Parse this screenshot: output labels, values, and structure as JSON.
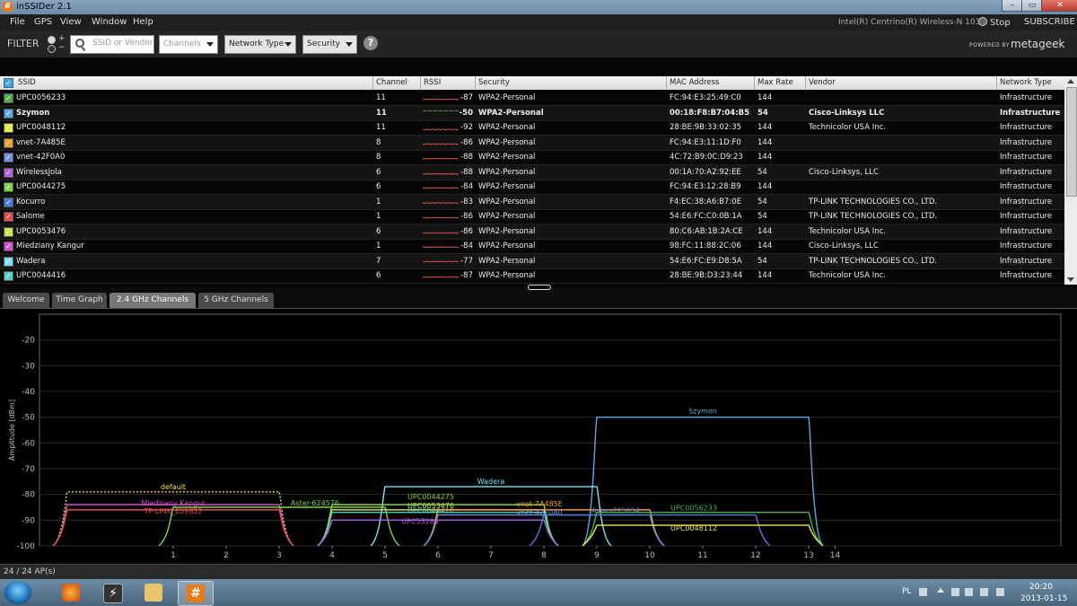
{
  "window": {
    "title": "inSSIDer 2.1",
    "app_icon": "#"
  },
  "menu": {
    "items": [
      "File",
      "GPS",
      "View",
      "Window",
      "Help"
    ],
    "adapter": "Intel(R) Centrino(R) Wireless-N 1030",
    "stop": "Stop",
    "subscribe": "SUBSCRIBE"
  },
  "filter": {
    "label": "FILTER",
    "plus": "+",
    "minus": "−",
    "search_placeholder": "SSID or Vendor",
    "channels": "Channels",
    "network_type": "Network Type",
    "security": "Security",
    "help": "?",
    "powered_by": "POWERED BY",
    "brand": "metageek"
  },
  "table": {
    "columns": [
      "SSID",
      "Channel",
      "RSSI",
      "Security",
      "MAC Address",
      "Max Rate",
      "Vendor",
      "Network Type"
    ],
    "rows": [
      {
        "ssid": "UPC0056233",
        "channel": "11",
        "rssi": "-87",
        "security": "WPA2-Personal",
        "mac": "FC:94:E3:25:49:C0",
        "rate": "144",
        "vendor": "",
        "type": "Infrastructure",
        "color": "#4caf50"
      },
      {
        "ssid": "Szymon",
        "channel": "11",
        "rssi": "-50",
        "security": "WPA2-Personal",
        "mac": "00:18:F8:B7:04:B5",
        "rate": "54",
        "vendor": "Cisco-Linksys LLC",
        "type": "Infrastructure",
        "color": "#5aa9e6"
      },
      {
        "ssid": "UPC0048112",
        "channel": "11",
        "rssi": "-92",
        "security": "WPA2-Personal",
        "mac": "28:BE:9B:33:02:35",
        "rate": "144",
        "vendor": "Technicolor USA Inc.",
        "type": "Infrastructure",
        "color": "#e8e84a"
      },
      {
        "ssid": "vnet-7A485E",
        "channel": "8",
        "rssi": "-86",
        "security": "WPA2-Personal",
        "mac": "FC:94:E3:11:1D:F0",
        "rate": "144",
        "vendor": "",
        "type": "Infrastructure",
        "color": "#f0a030"
      },
      {
        "ssid": "vnet-42F0A0",
        "channel": "8",
        "rssi": "-88",
        "security": "WPA2-Personal",
        "mac": "4C:72:B9:0C:D9:23",
        "rate": "144",
        "vendor": "",
        "type": "Infrastructure",
        "color": "#6f8fe0"
      },
      {
        "ssid": "WirelessJola",
        "channel": "6",
        "rssi": "-88",
        "security": "WPA2-Personal",
        "mac": "00:1A:70:A2:92:EE",
        "rate": "54",
        "vendor": "Cisco-Linksys, LLC",
        "type": "Infrastructure",
        "color": "#b060e0"
      },
      {
        "ssid": "UPC0044275",
        "channel": "6",
        "rssi": "-84",
        "security": "WPA2-Personal",
        "mac": "FC:94:E3:12:28:B9",
        "rate": "144",
        "vendor": "",
        "type": "Infrastructure",
        "color": "#7fd34a"
      },
      {
        "ssid": "Kocurro",
        "channel": "1",
        "rssi": "-83",
        "security": "WPA2-Personal",
        "mac": "F4:EC:38:A6:B7:0E",
        "rate": "54",
        "vendor": "TP-LINK TECHNOLOGIES CO., LTD.",
        "type": "Infrastructure",
        "color": "#4a7de0"
      },
      {
        "ssid": "Salome",
        "channel": "1",
        "rssi": "-86",
        "security": "WPA2-Personal",
        "mac": "54:E6:FC:C0:0B:1A",
        "rate": "54",
        "vendor": "TP-LINK TECHNOLOGIES CO., LTD.",
        "type": "Infrastructure",
        "color": "#e05050"
      },
      {
        "ssid": "UPC0053476",
        "channel": "6",
        "rssi": "-86",
        "security": "WPA2-Personal",
        "mac": "80:C6:AB:1B:2A:CE",
        "rate": "144",
        "vendor": "Technicolor USA Inc.",
        "type": "Infrastructure",
        "color": "#c8e04a"
      },
      {
        "ssid": "Miedziany Kangur",
        "channel": "1",
        "rssi": "-84",
        "security": "WPA2-Personal",
        "mac": "98:FC:11:88:2C:06",
        "rate": "144",
        "vendor": "Cisco-Linksys, LLC",
        "type": "Infrastructure",
        "color": "#d050d0"
      },
      {
        "ssid": "Wadera",
        "channel": "7",
        "rssi": "-77",
        "security": "WPA2-Personal",
        "mac": "54:E6:FC:E9:D8:5A",
        "rate": "54",
        "vendor": "TP-LINK TECHNOLOGIES CO., LTD.",
        "type": "Infrastructure",
        "color": "#7fe0f0"
      },
      {
        "ssid": "UPC0044416",
        "channel": "6",
        "rssi": "-87",
        "security": "WPA2-Personal",
        "mac": "28:BE:9B:D3:23:44",
        "rate": "144",
        "vendor": "Technicolor USA Inc.",
        "type": "Infrastructure",
        "color": "#50d0c0"
      }
    ]
  },
  "tabs": [
    "Welcome",
    "Time Graph",
    "2.4 GHz Channels",
    "5 GHz Channels"
  ],
  "active_tab": "2.4 GHz Channels",
  "chart_data": {
    "type": "area",
    "ylabel": "Amplitude [dBm]",
    "ylim": [
      -100,
      -10
    ],
    "yticks": [
      -20,
      -30,
      -40,
      -50,
      -60,
      -70,
      -80,
      -90,
      -100
    ],
    "xticks": [
      "1",
      "2",
      "3",
      "4",
      "5",
      "6",
      "7",
      "8",
      "9",
      "10",
      "11",
      "12",
      "13",
      "14"
    ],
    "series": [
      {
        "name": "Szymon",
        "channel": 11,
        "rssi": -50,
        "color": "#5aa9e6"
      },
      {
        "name": "Wadera",
        "channel": 7,
        "rssi": -77,
        "color": "#7fe0f0"
      },
      {
        "name": "default",
        "channel": 1,
        "rssi": -79,
        "color": "#f0e050",
        "dashed": true
      },
      {
        "name": "Miedziany Kangur",
        "channel": 1,
        "rssi": -84,
        "color": "#d050d0"
      },
      {
        "name": "TP-LINK_E59852",
        "channel": 1,
        "rssi": -86,
        "color": "#e05050"
      },
      {
        "name": "Aster-624576",
        "channel": 3,
        "rssi": -85,
        "color": "#7fd34a"
      },
      {
        "name": "UPC0044275",
        "channel": 6,
        "rssi": -84,
        "color": "#7fd34a"
      },
      {
        "name": "UPC0053476",
        "channel": 6,
        "rssi": -86,
        "color": "#c8e04a"
      },
      {
        "name": "UPC0044416",
        "channel": 6,
        "rssi": -87,
        "color": "#50d0c0"
      },
      {
        "name": "UPC53284",
        "channel": 6,
        "rssi": -90,
        "color": "#b060e0"
      },
      {
        "name": "vnet-7A485E",
        "channel": 8,
        "rssi": -86,
        "color": "#f0a030"
      },
      {
        "name": "vnet-42F0A0",
        "channel": 8,
        "rssi": -88,
        "color": "#6f8fe0"
      },
      {
        "name": "Aster-725054",
        "channel": 10,
        "rssi": -88,
        "color": "#4a7de0"
      },
      {
        "name": "UPC0056233",
        "channel": 11,
        "rssi": -87,
        "color": "#4caf50"
      },
      {
        "name": "UPC0048112",
        "channel": 11,
        "rssi": -92,
        "color": "#e8e84a"
      }
    ]
  },
  "status": {
    "count": "24 / 24 AP(s)"
  },
  "taskbar": {
    "lang": "PL",
    "time": "20:20",
    "date": "2013-01-15"
  }
}
